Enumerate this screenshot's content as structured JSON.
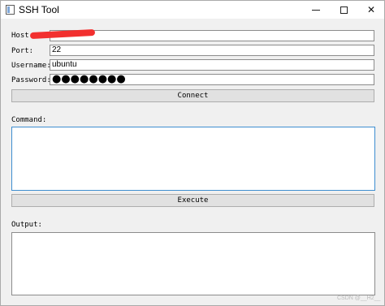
{
  "window": {
    "title": "SSH Tool",
    "min_icon": "minimize-icon",
    "max_icon": "maximize-icon",
    "close_icon": "close-icon",
    "close_glyph": "✕"
  },
  "form": {
    "host_label": "Host:",
    "host_value": "",
    "port_label": "Port:",
    "port_value": "22",
    "username_label": "Username:",
    "username_value": "ubuntu",
    "password_label": "Password:",
    "password_mask": "●●●●●●●●",
    "connect_label": "Connect"
  },
  "command": {
    "label": "Command:",
    "value": "",
    "execute_label": "Execute"
  },
  "output": {
    "label": "Output:",
    "value": ""
  },
  "watermark": "CSDN @__H2__",
  "colors": {
    "redaction": "#f2302f",
    "focus_border": "#3e8ed0"
  }
}
